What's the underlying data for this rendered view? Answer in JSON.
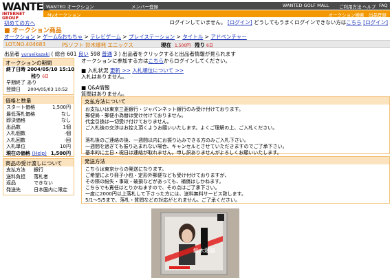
{
  "header": {
    "logo_big": "WANTED",
    "logo_sub1": "INTERNET",
    "logo_sub2": "GROUP",
    "top_links": [
      "WANTED オークション",
      "メンバー登録",
      "WANTED GOLF MALL",
      "ご利用方法",
      "ヘルプ",
      "FAQ"
    ],
    "orange_left": "Myオークション",
    "orange_right": "オークション検索　出品登録"
  },
  "login": {
    "status": "ログインしていません。",
    "login_link": "[ログイン]",
    "prompt": "どうしてもうまくログインできない方は",
    "help_link": "こちら",
    "login_link2": "[ログイン]"
  },
  "back_link": "初めての方へ",
  "section_title": "■ オークション商品",
  "breadcrumb": [
    "オークション",
    "ゲーム&おもちゃ",
    "テレビゲーム",
    "プレイステーション",
    "タイトル",
    "アドベンチャー"
  ],
  "lot": {
    "lot_no": "LOT.NO.404683",
    "title": "PSソフト 鈴木爆発 エニックス",
    "current_label": "現在",
    "current_price": "1,500円",
    "remaining_label": "残り",
    "remaining": "6日"
  },
  "seller": {
    "label": "出品者",
    "name": "yurueikazaki",
    "total": "( 総合 601",
    "good": "良い",
    "good_count": "598",
    "normal": "普通",
    "normal_count": "3 )",
    "note": "出品者をクリックすると出品者情報が見られます"
  },
  "period": {
    "heading": "オークションの期間",
    "end_label": "終了日時",
    "end_value": "2004/05/10 15:10",
    "remain_label": "残り",
    "remain_value": "6日",
    "early_end": "早期終了 あり",
    "reg_label": "登録日",
    "reg_value": "2004/05/03 10:52"
  },
  "price": {
    "heading": "価格と数量",
    "rows": [
      {
        "label": "スタート価格",
        "value": "1,500円"
      },
      {
        "label": "最低落札価格",
        "value": "なし"
      },
      {
        "label": "即決価格",
        "value": "なし"
      },
      {
        "label": "出品数",
        "value": "1個"
      },
      {
        "label": "入札個数",
        "value": "-個"
      },
      {
        "label": "入札回数",
        "value": "-回"
      },
      {
        "label": "入札単位",
        "value": "10円"
      }
    ],
    "current_label": "現在の価格",
    "help": "(Help)",
    "current_value": "1,500円"
  },
  "delivery": {
    "heading": "商品の受け渡しについて",
    "rows": [
      {
        "label": "支払方法",
        "value": "銀行"
      },
      {
        "label": "送料負担",
        "value": "落札者"
      },
      {
        "label": "返品",
        "value": "できない"
      },
      {
        "label": "発送先",
        "value": "日本国内に限定"
      }
    ]
  },
  "join": {
    "prefix": "オークションに参加する方は",
    "link": "こちら",
    "suffix": "からログインしてください。"
  },
  "bids": {
    "title": "■ 入札状況",
    "update": "更新 >>",
    "ranking": "入札順位について >>",
    "none": "入札はありません。"
  },
  "qa": {
    "title": "■ Q&A情報",
    "none": "質問はありません。"
  },
  "payment": {
    "heading": "支払方法について",
    "lines": [
      "お支払いは東京三菱銀行・ジャパンネット銀行のみ受け付けております。",
      "郵便局・郵便小為替は受け付けておりません。",
      "代金引換は一切受け付けておりません。",
      "ご入札後の交渉はお控え頂くようお願いいたします。よくご理解の上、ご入札ください。",
      "",
      "落札後のご連絡の後、一週間以内にお振り込みできる方のみご入札下さい。",
      "一週間を過ぎても振り込まれない場合、キャンセルとさせていただきますのでご了承下さい。",
      "基本的に土日・祝日は連絡が取れません。申し訳ありませんがよろしくお願いいたします。"
    ]
  },
  "shipping": {
    "heading": "発送方法",
    "lines": [
      "こちらは東京からの発送になります。",
      "ご希望により冊子小包・定形外郵便なども受け付けておりますが、",
      "その際の紛失・事故・破損などがあっても、補償はしかねます。",
      "こちらでも責任はとりかねますので、その点はご了承下さい。",
      "一度に2000円以上落札して下さった方には、送料無料サービス致します。",
      "5/1～5/5まで、落札・質問などの対応がとれません。ご了承ください。"
    ]
  },
  "product_image": {
    "cover_text": "鈴木爆発",
    "colors": {
      "case": "#c9c6c2",
      "red": "#e0201c",
      "bg": "#b8aea2"
    }
  }
}
